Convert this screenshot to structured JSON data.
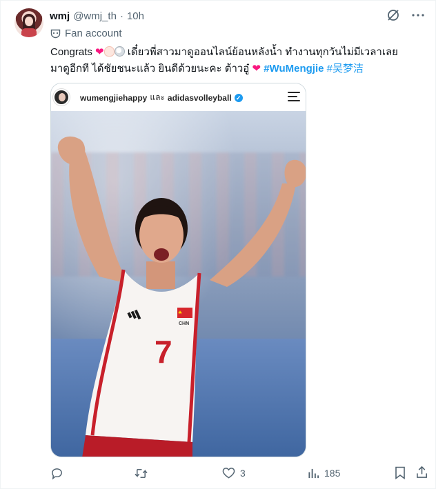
{
  "user": {
    "display_name": "wmj",
    "handle": "@wmj_th",
    "separator": "·",
    "time": "10h",
    "label": "Fan account"
  },
  "tweet": {
    "line1_start": "Congrats",
    "line1_thai": "เดี๋ยวพี่สาวมาดูออนไลน์ย้อนหลังน้ำ ทำงานทุกวันไม่มีเวลาเลย",
    "line2_thai": "มาดูอีกที ได้ชัยชนะแล้ว  ยินดีด้วยนะคะ ต้าวอู๋",
    "hashtag1": "#WuMengjie",
    "hashtag2": "#吴梦洁"
  },
  "media": {
    "account1": "wumengjiehappy",
    "connector": "และ",
    "account2": "adidasvolleyball",
    "jersey_number": "7",
    "jersey_country": "CHN"
  },
  "actions": {
    "reply_count": "",
    "retweet_count": "",
    "like_count": "3",
    "view_count": "185"
  },
  "colors": {
    "accent": "#1d9bf0",
    "heart": "#f91880",
    "muted": "#536471"
  }
}
